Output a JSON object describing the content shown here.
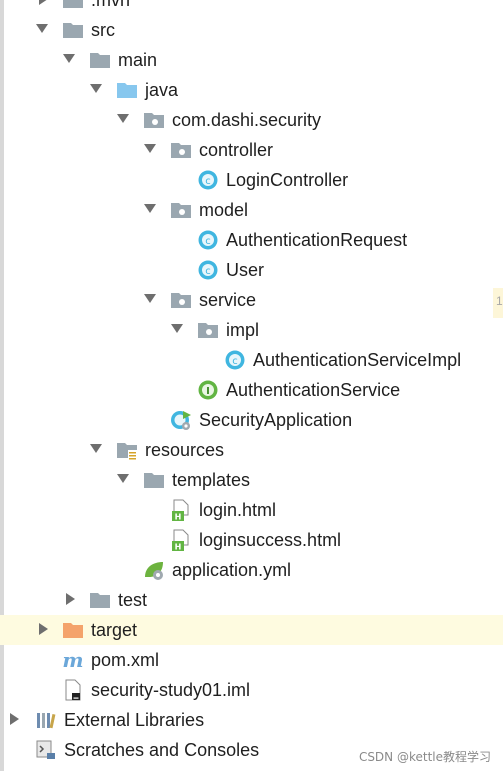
{
  "tree": {
    "items": [
      {
        "label": ".mvn",
        "icon": "folder-icon"
      },
      {
        "label": "src",
        "icon": "folder-icon"
      },
      {
        "label": "main",
        "icon": "folder-icon"
      },
      {
        "label": "java",
        "icon": "source-folder-icon"
      },
      {
        "label": "com.dashi.security",
        "icon": "package-icon"
      },
      {
        "label": "controller",
        "icon": "package-icon"
      },
      {
        "label": "LoginController",
        "icon": "class-icon"
      },
      {
        "label": "model",
        "icon": "package-icon"
      },
      {
        "label": "AuthenticationRequest",
        "icon": "class-icon"
      },
      {
        "label": "User",
        "icon": "class-icon"
      },
      {
        "label": "service",
        "icon": "package-icon"
      },
      {
        "label": "impl",
        "icon": "package-icon"
      },
      {
        "label": "AuthenticationServiceImpl",
        "icon": "class-icon"
      },
      {
        "label": "AuthenticationService",
        "icon": "interface-icon"
      },
      {
        "label": "SecurityApplication",
        "icon": "spring-boot-class-icon"
      },
      {
        "label": "resources",
        "icon": "resources-folder-icon"
      },
      {
        "label": "templates",
        "icon": "folder-icon"
      },
      {
        "label": "login.html",
        "icon": "html-file-icon"
      },
      {
        "label": "loginsuccess.html",
        "icon": "html-file-icon"
      },
      {
        "label": "application.yml",
        "icon": "spring-config-icon"
      },
      {
        "label": "test",
        "icon": "folder-icon"
      },
      {
        "label": "target",
        "icon": "excluded-folder-icon"
      },
      {
        "label": "pom.xml",
        "icon": "maven-icon"
      },
      {
        "label": "security-study01.iml",
        "icon": "iml-file-icon"
      },
      {
        "label": "External Libraries",
        "icon": "libraries-icon"
      },
      {
        "label": "Scratches and Consoles",
        "icon": "scratches-icon"
      }
    ]
  },
  "edge_fragment": "1",
  "watermark": "CSDN @kettle教程学习",
  "colors": {
    "folder": "#9aa7b0",
    "source_folder": "#87c7ee",
    "class": "#40b6e0",
    "interface": "#62b543",
    "excluded_folder": "#f4a36b",
    "maven": "#6ba7d9",
    "highlight": "#fefbe0"
  }
}
